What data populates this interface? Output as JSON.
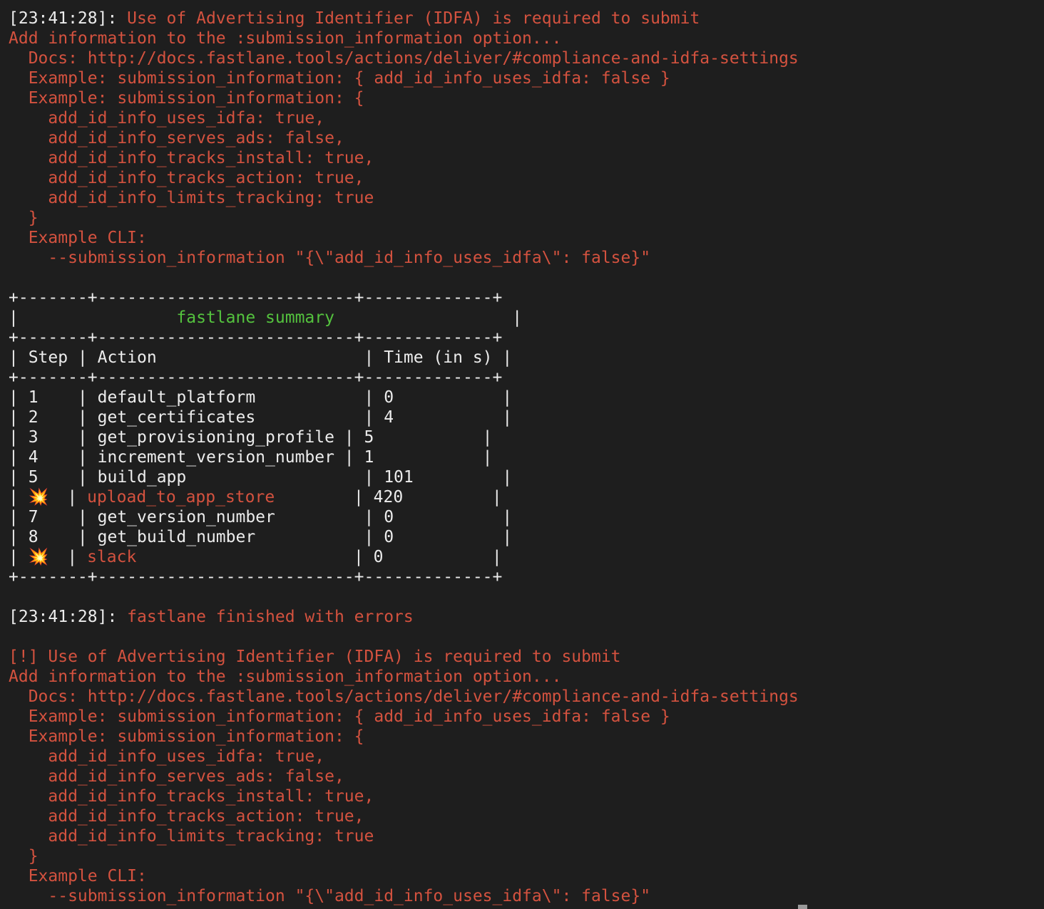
{
  "colors": {
    "background": "#1e1e1e",
    "text": "#ececec",
    "error": "#d4523f",
    "header": "#54c23e",
    "failed_step_icon": "#ffd23a"
  },
  "top_edge": "+-------+-------------------------+-------------+",
  "terminal_lines": [
    [
      {
        "c": "white",
        "t": "[23:41:28]: "
      },
      {
        "c": "red",
        "t": "Use of Advertising Identifier (IDFA) is required to submit"
      }
    ],
    [
      {
        "c": "red",
        "t": "Add information to the :submission_information option..."
      }
    ],
    [
      {
        "c": "red",
        "t": "  Docs: http://docs.fastlane.tools/actions/deliver/#compliance-and-idfa-settings"
      }
    ],
    [
      {
        "c": "red",
        "t": "  Example: submission_information: { add_id_info_uses_idfa: false }"
      }
    ],
    [
      {
        "c": "red",
        "t": "  Example: submission_information: {"
      }
    ],
    [
      {
        "c": "red",
        "t": "    add_id_info_uses_idfa: true,"
      }
    ],
    [
      {
        "c": "red",
        "t": "    add_id_info_serves_ads: false,"
      }
    ],
    [
      {
        "c": "red",
        "t": "    add_id_info_tracks_install: true,"
      }
    ],
    [
      {
        "c": "red",
        "t": "    add_id_info_tracks_action: true,"
      }
    ],
    [
      {
        "c": "red",
        "t": "    add_id_info_limits_tracking: true"
      }
    ],
    [
      {
        "c": "red",
        "t": "  }"
      }
    ],
    [
      {
        "c": "red",
        "t": "  Example CLI:"
      }
    ],
    [
      {
        "c": "red",
        "t": "    --submission_information \"{\\\"add_id_info_uses_idfa\\\": false}\""
      }
    ],
    [],
    [
      {
        "c": "white",
        "t": "+-------+--------------------------+-------------+"
      }
    ],
    [
      {
        "c": "white",
        "t": "|                "
      },
      {
        "c": "green",
        "t": "fastlane summary"
      },
      {
        "c": "white",
        "t": "                  |"
      }
    ],
    [
      {
        "c": "white",
        "t": "+-------+--------------------------+-------------+"
      }
    ],
    [
      {
        "c": "white",
        "t": "| Step | Action                     | Time (in s) |"
      }
    ],
    [
      {
        "c": "white",
        "t": "+-------+--------------------------+-------------+"
      }
    ],
    [
      {
        "c": "white",
        "t": "| 1    | default_platform           | 0           |"
      }
    ],
    [
      {
        "c": "white",
        "t": "| 2    | get_certificates           | 4           |"
      }
    ],
    [
      {
        "c": "white",
        "t": "| 3    | get_provisioning_profile | 5           |"
      }
    ],
    [
      {
        "c": "white",
        "t": "| 4    | increment_version_number | 1           |"
      }
    ],
    [
      {
        "c": "white",
        "t": "| 5    | build_app                  | 101         |"
      }
    ],
    [
      {
        "c": "white",
        "t": "| "
      },
      {
        "c": "emoji",
        "t": "💥"
      },
      {
        "c": "white",
        "t": "  | "
      },
      {
        "c": "red",
        "t": "upload_to_app_store"
      },
      {
        "c": "white",
        "t": "        | 420         |"
      }
    ],
    [
      {
        "c": "white",
        "t": "| 7    | get_version_number         | 0           |"
      }
    ],
    [
      {
        "c": "white",
        "t": "| 8    | get_build_number           | 0           |"
      }
    ],
    [
      {
        "c": "white",
        "t": "| "
      },
      {
        "c": "emoji",
        "t": "💥"
      },
      {
        "c": "white",
        "t": "  | "
      },
      {
        "c": "red",
        "t": "slack"
      },
      {
        "c": "white",
        "t": "                      | 0           |"
      }
    ],
    [
      {
        "c": "white",
        "t": "+-------+--------------------------+-------------+"
      }
    ],
    [],
    [
      {
        "c": "white",
        "t": "[23:41:28]: "
      },
      {
        "c": "red",
        "t": "fastlane finished with errors"
      }
    ],
    [],
    [
      {
        "c": "red",
        "t": "[!] Use of Advertising Identifier (IDFA) is required to submit"
      }
    ],
    [
      {
        "c": "red",
        "t": "Add information to the :submission_information option..."
      }
    ],
    [
      {
        "c": "red",
        "t": "  Docs: http://docs.fastlane.tools/actions/deliver/#compliance-and-idfa-settings"
      }
    ],
    [
      {
        "c": "red",
        "t": "  Example: submission_information: { add_id_info_uses_idfa: false }"
      }
    ],
    [
      {
        "c": "red",
        "t": "  Example: submission_information: {"
      }
    ],
    [
      {
        "c": "red",
        "t": "    add_id_info_uses_idfa: true,"
      }
    ],
    [
      {
        "c": "red",
        "t": "    add_id_info_serves_ads: false,"
      }
    ],
    [
      {
        "c": "red",
        "t": "    add_id_info_tracks_install: true,"
      }
    ],
    [
      {
        "c": "red",
        "t": "    add_id_info_tracks_action: true,"
      }
    ],
    [
      {
        "c": "red",
        "t": "    add_id_info_limits_tracking: true"
      }
    ],
    [
      {
        "c": "red",
        "t": "  }"
      }
    ],
    [
      {
        "c": "red",
        "t": "  Example CLI:"
      }
    ],
    [
      {
        "c": "red",
        "t": "    --submission_information \"{\\\"add_id_info_uses_idfa\\\": false}\""
      }
    ]
  ]
}
